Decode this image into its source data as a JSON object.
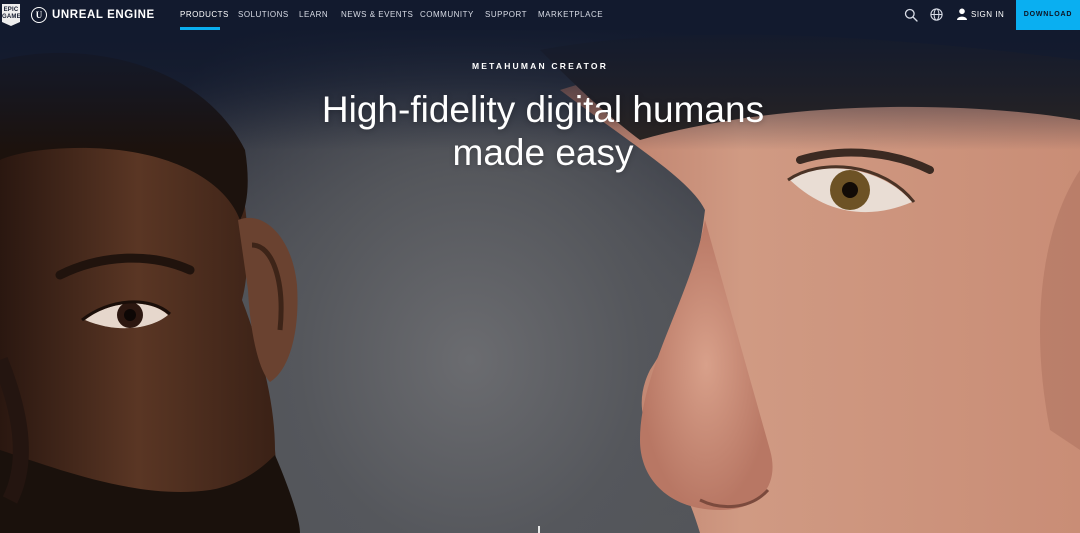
{
  "brand": {
    "epic_logo_text": "EPIC GAMES",
    "name": "UNREAL ENGINE"
  },
  "nav": {
    "items": [
      {
        "label": "PRODUCTS",
        "active": true
      },
      {
        "label": "SOLUTIONS",
        "active": false
      },
      {
        "label": "LEARN",
        "active": false
      },
      {
        "label": "NEWS & EVENTS",
        "active": false
      },
      {
        "label": "COMMUNITY",
        "active": false
      },
      {
        "label": "SUPPORT",
        "active": false
      },
      {
        "label": "MARKETPLACE",
        "active": false
      }
    ],
    "icons": [
      "search-icon",
      "globe-icon",
      "user-icon"
    ],
    "sign_in": "SIGN IN",
    "download": "DOWNLOAD"
  },
  "hero": {
    "eyebrow": "METAHUMAN CREATOR",
    "headline_line1": "High-fidelity digital humans",
    "headline_line2": "made easy"
  },
  "colors": {
    "nav_bg": "#121a2e",
    "accent": "#0aaff1",
    "text": "#ffffff"
  }
}
